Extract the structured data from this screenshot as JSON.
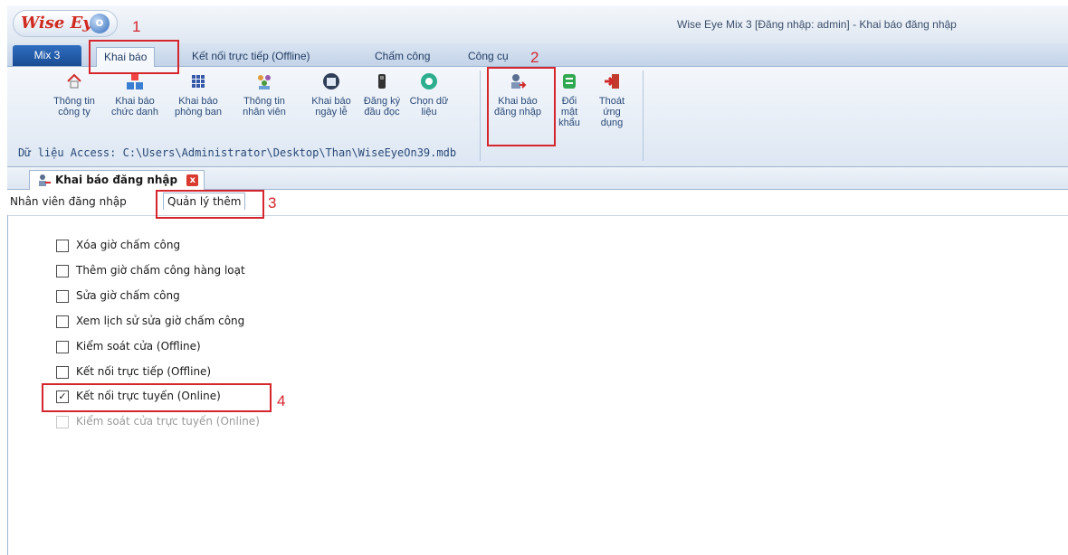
{
  "window": {
    "title": "Wise Eye Mix 3 [Đăng nhập: admin] - Khai báo đăng nhập",
    "logo_text": "Wise Eye",
    "logo_mark": "o"
  },
  "menu_tabs": [
    {
      "label": "Mix 3"
    },
    {
      "label": "Khai báo"
    },
    {
      "label": "Kết nối trực tiếp (Offline)"
    },
    {
      "label": "Chấm công"
    },
    {
      "label": "Công cụ"
    }
  ],
  "ribbon": {
    "buttons": [
      {
        "label": "Thông tin công ty",
        "icon": "house-icon"
      },
      {
        "label": "Khai báo chức danh",
        "icon": "abc-blocks-icon"
      },
      {
        "label": "Khai báo phòng ban",
        "icon": "grid-icon"
      },
      {
        "label": "Thông tin nhân viên",
        "icon": "people-icon"
      },
      {
        "label": "Khai báo ngày lễ",
        "icon": "calendar-icon"
      },
      {
        "label": "Đăng ký đầu đọc",
        "icon": "reader-device-icon"
      },
      {
        "label": "Chọn dữ liệu",
        "icon": "data-select-icon"
      },
      {
        "label": "Khai báo đăng nhập",
        "icon": "user-login-icon"
      },
      {
        "label": "Đổi mật khẩu",
        "icon": "change-password-icon"
      },
      {
        "label": "Thoát ứng dụng",
        "icon": "exit-icon"
      }
    ],
    "data_path": "Dữ liệu Access: C:\\Users\\Administrator\\Desktop\\Than\\WiseEyeOn39.mdb"
  },
  "document_tab": {
    "label": "Khai báo đăng nhập",
    "close": "x"
  },
  "sub_tabs": [
    {
      "label": "Nhân viên đăng nhập"
    },
    {
      "label": "Quản lý thêm"
    }
  ],
  "options": [
    {
      "label": "Xóa giờ chấm công",
      "checked": false,
      "enabled": true,
      "mark": ""
    },
    {
      "label": "Thêm giờ chấm công hàng loạt",
      "checked": false,
      "enabled": true,
      "mark": ""
    },
    {
      "label": "Sửa giờ chấm công",
      "checked": false,
      "enabled": true,
      "mark": ""
    },
    {
      "label": "Xem lịch sử sửa giờ chấm công",
      "checked": false,
      "enabled": true,
      "mark": ""
    },
    {
      "label": "Kiểm soát cửa (Offline)",
      "checked": false,
      "enabled": true,
      "mark": ""
    },
    {
      "label": "Kết nối trực tiếp (Offline)",
      "checked": false,
      "enabled": true,
      "mark": ""
    },
    {
      "label": "Kết nối trực tuyến (Online)",
      "checked": true,
      "enabled": true,
      "mark": "✓"
    },
    {
      "label": "Kiểm soát cửa trực tuyến (Online)",
      "checked": false,
      "enabled": false,
      "mark": ""
    }
  ],
  "annotations": [
    "1",
    "2",
    "3",
    "4"
  ],
  "colors": {
    "annotation": "#d6262d",
    "app_tab": "#1a4c93"
  }
}
